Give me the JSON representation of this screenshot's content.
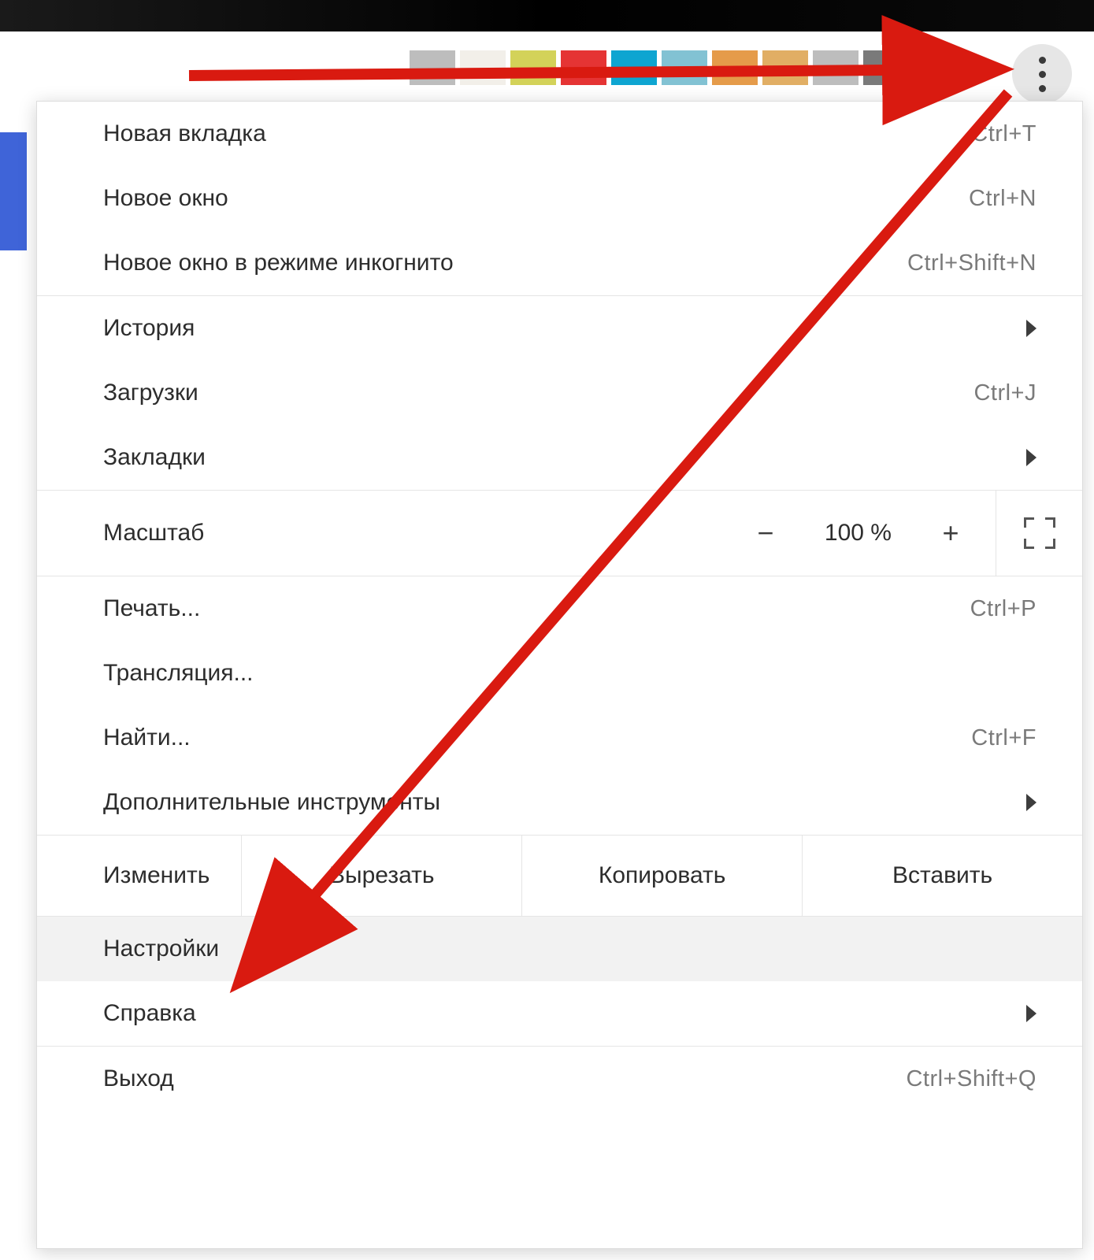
{
  "tab_swatches": [
    "#bdbdbd",
    "#f2efe9",
    "#d3d259",
    "#e53434",
    "#0ea5d1",
    "#82c2d3",
    "#e59b4a",
    "#e1ae64",
    "#bdbdbd",
    "#7a7a7a"
  ],
  "menu": {
    "group1": [
      {
        "label": "Новая вкладка",
        "shortcut": "Ctrl+T",
        "submenu": false
      },
      {
        "label": "Новое окно",
        "shortcut": "Ctrl+N",
        "submenu": false
      },
      {
        "label": "Новое окно в режиме инкогнито",
        "shortcut": "Ctrl+Shift+N",
        "submenu": false
      }
    ],
    "group2": [
      {
        "label": "История",
        "shortcut": "",
        "submenu": true
      },
      {
        "label": "Загрузки",
        "shortcut": "Ctrl+J",
        "submenu": false
      },
      {
        "label": "Закладки",
        "shortcut": "",
        "submenu": true
      }
    ],
    "zoom": {
      "label": "Масштаб",
      "minus": "−",
      "value": "100 %",
      "plus": "+"
    },
    "group3": [
      {
        "label": "Печать...",
        "shortcut": "Ctrl+P",
        "submenu": false
      },
      {
        "label": "Трансляция...",
        "shortcut": "",
        "submenu": false
      },
      {
        "label": "Найти...",
        "shortcut": "Ctrl+F",
        "submenu": false
      },
      {
        "label": "Дополнительные инструменты",
        "shortcut": "",
        "submenu": true
      }
    ],
    "edit": {
      "label": "Изменить",
      "cut": "Вырезать",
      "copy": "Копировать",
      "paste": "Вставить"
    },
    "group4": [
      {
        "label": "Настройки",
        "shortcut": "",
        "submenu": false,
        "highlight": true
      },
      {
        "label": "Справка",
        "shortcut": "",
        "submenu": true
      }
    ],
    "group5": [
      {
        "label": "Выход",
        "shortcut": "Ctrl+Shift+Q",
        "submenu": false
      }
    ]
  },
  "annotation": {
    "color": "#d91a10"
  }
}
